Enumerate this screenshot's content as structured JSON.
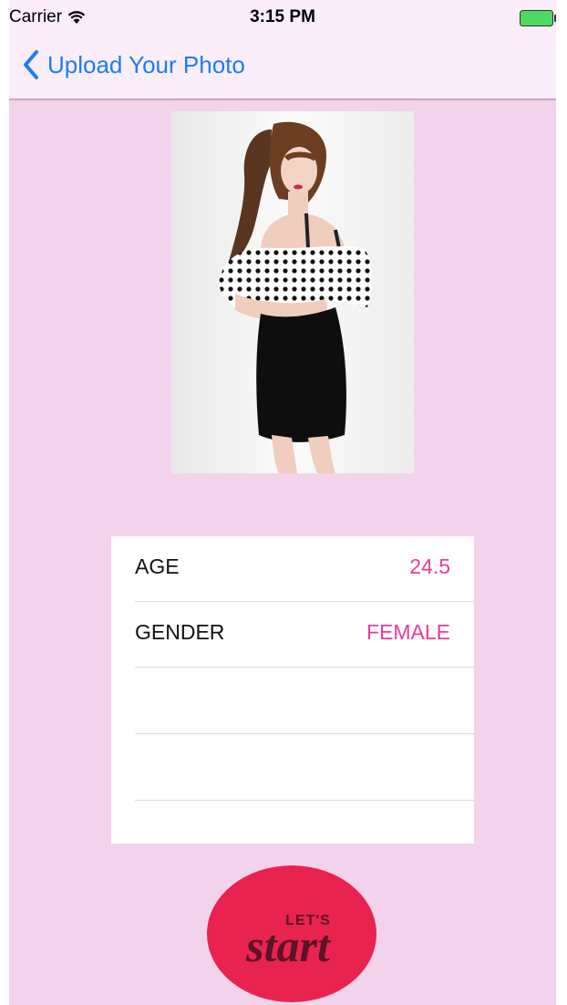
{
  "status_bar": {
    "carrier": "Carrier",
    "time": "3:15 PM",
    "icons": [
      "wifi-icon",
      "battery-icon"
    ]
  },
  "nav": {
    "back_label": "Upload Your Photo",
    "back_icon": "chevron-left-icon"
  },
  "info": {
    "rows": [
      {
        "label": "AGE",
        "value": "24.5"
      },
      {
        "label": "GENDER",
        "value": "FEMALE"
      },
      {
        "label": "",
        "value": ""
      },
      {
        "label": "",
        "value": ""
      }
    ]
  },
  "start_button": {
    "label_small": "LET'S",
    "label_large": "start"
  },
  "colors": {
    "background": "#f3d3ec",
    "nav_background": "#fbeefa",
    "accent_blue": "#1a7ef5",
    "value_pink": "#f0399a",
    "button_red": "#e8234f",
    "battery_green": "#4cd964"
  }
}
